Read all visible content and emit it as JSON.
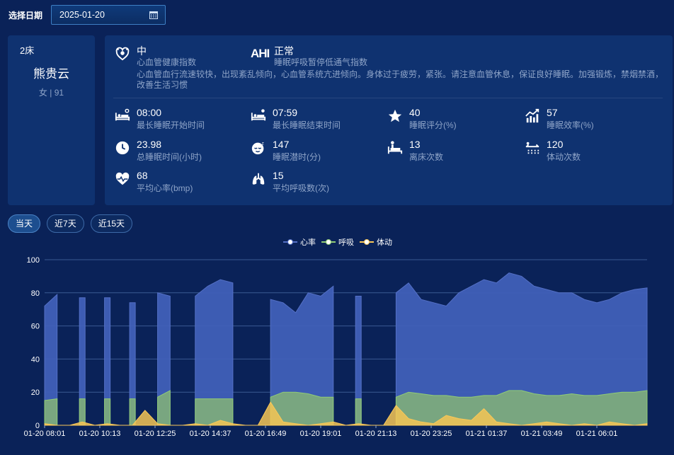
{
  "header": {
    "date_label": "选择日期",
    "date_value": "2025-01-20"
  },
  "patient": {
    "bed": "2床",
    "name": "熊贵云",
    "info": "女 | 91"
  },
  "health": {
    "cardio": {
      "value": "中",
      "label": "心血管健康指数"
    },
    "ahi": {
      "icon_text": "AHI",
      "value": "正常",
      "label": "睡眠呼吸暂停低通气指数"
    },
    "description": "心血管血行流速较快，出现紊乱倾向，心血管系统亢进倾向。身体过于疲劳，紧张。请注意血管休息，保证良好睡眠。加强锻炼，禁烟禁酒，改善生活习惯"
  },
  "stats": [
    {
      "value": "08:00",
      "label": "最长睡眠开始时间",
      "icon": "bed-start-icon"
    },
    {
      "value": "07:59",
      "label": "最长睡眠结束时间",
      "icon": "bed-end-icon"
    },
    {
      "value": "40",
      "label": "睡眠评分(%)",
      "icon": "star-icon"
    },
    {
      "value": "57",
      "label": "睡眠效率(%)",
      "icon": "trend-chart-icon"
    },
    {
      "value": "23.98",
      "label": "总睡眠时间(小时)",
      "icon": "clock-icon"
    },
    {
      "value": "147",
      "label": "睡眠潜时(分)",
      "icon": "sleep-face-icon"
    },
    {
      "value": "13",
      "label": "离床次数",
      "icon": "leave-bed-icon"
    },
    {
      "value": "120",
      "label": "体动次数",
      "icon": "body-move-icon"
    },
    {
      "value": "68",
      "label": "平均心率(bmp)",
      "icon": "heart-rate-icon"
    },
    {
      "value": "15",
      "label": "平均呼吸数(次)",
      "icon": "lungs-icon"
    }
  ],
  "tabs": [
    "当天",
    "近7天",
    "近15天"
  ],
  "active_tab": 0,
  "chart_data": {
    "type": "area",
    "legend_position": "top-center",
    "ylim": [
      0,
      100
    ],
    "yticks": [
      0,
      20,
      40,
      60,
      80,
      100
    ],
    "x": [
      "01-20 08:01",
      "01-20 10:13",
      "01-20 12:25",
      "01-20 14:37",
      "01-20 16:49",
      "01-20 19:01",
      "01-20 21:13",
      "01-20 23:25",
      "01-21 01:37",
      "01-21 03:49",
      "01-21 06:01"
    ],
    "series": [
      {
        "name": "心率",
        "color": "#5470c6",
        "values": [
          72,
          79,
          0,
          77,
          0,
          77,
          0,
          74,
          0,
          80,
          78,
          0,
          78,
          84,
          88,
          86,
          0,
          0,
          76,
          74,
          68,
          80,
          78,
          84,
          0,
          78,
          0,
          0,
          80,
          86,
          76,
          74,
          72,
          80,
          84,
          88,
          86,
          92,
          90,
          84,
          82,
          80,
          80,
          76,
          74,
          76,
          80,
          82,
          83
        ]
      },
      {
        "name": "呼吸",
        "color": "#91cc75",
        "values": [
          15,
          16,
          0,
          16,
          0,
          16,
          0,
          16,
          0,
          17,
          21,
          0,
          16,
          16,
          16,
          16,
          0,
          0,
          17,
          20,
          20,
          19,
          17,
          17,
          0,
          16,
          0,
          0,
          17,
          20,
          19,
          18,
          18,
          17,
          17,
          18,
          18,
          21,
          21,
          19,
          18,
          18,
          19,
          18,
          18,
          19,
          20,
          20,
          21
        ]
      },
      {
        "name": "体动",
        "color": "#fac858",
        "values": [
          1,
          0,
          0,
          2,
          0,
          1,
          0,
          0,
          9,
          1,
          0,
          0,
          1,
          0,
          3,
          1,
          0,
          0,
          14,
          2,
          1,
          0,
          1,
          2,
          0,
          1,
          0,
          0,
          12,
          4,
          2,
          1,
          6,
          4,
          3,
          10,
          2,
          1,
          0,
          1,
          2,
          1,
          0,
          1,
          0,
          2,
          1,
          0,
          1
        ]
      }
    ]
  }
}
